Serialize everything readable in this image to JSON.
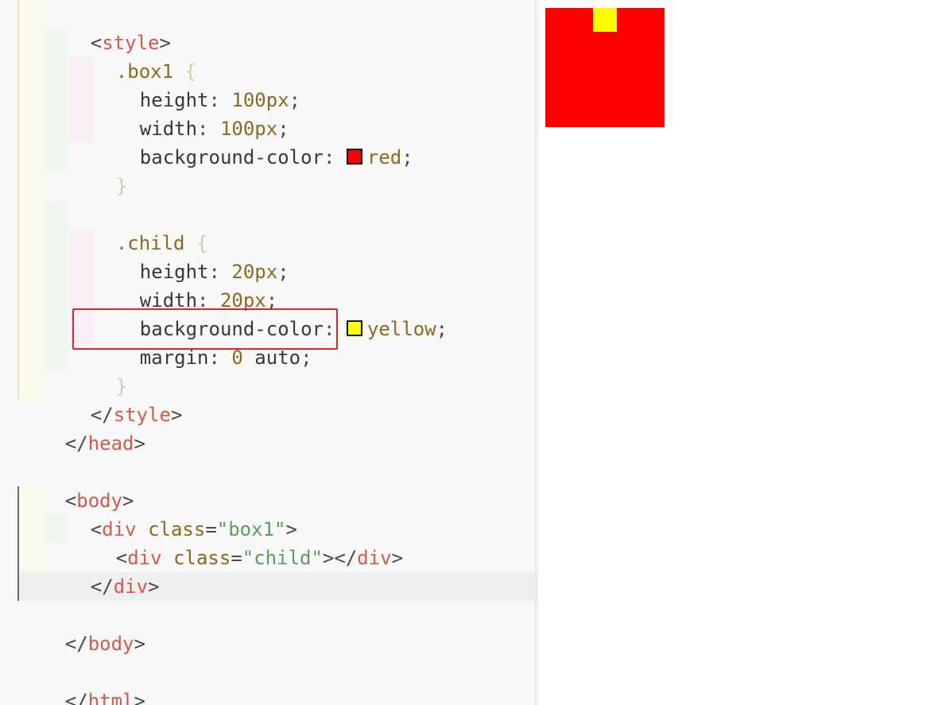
{
  "editor": {
    "lines": {
      "style_open": {
        "open": "<",
        "name": "style",
        "close": ">"
      },
      "box1_selector": {
        "selector": ".box1",
        "brace": "{"
      },
      "box1_height": {
        "prop": "height",
        "colon": ": ",
        "value": "100px",
        "semi": ";"
      },
      "box1_width": {
        "prop": "width",
        "colon": ": ",
        "value": "100px",
        "semi": ";"
      },
      "box1_bg": {
        "prop": "background-color",
        "colon": ": ",
        "value": "red",
        "semi": ";",
        "swatch": "#ff0000"
      },
      "box1_close": {
        "brace": "}"
      },
      "child_selector": {
        "selector": ".child",
        "brace": "{"
      },
      "child_height": {
        "prop": "height",
        "colon": ": ",
        "value": "20px",
        "semi": ";"
      },
      "child_width": {
        "prop": "width",
        "colon": ": ",
        "value": "20px",
        "semi": ";"
      },
      "child_bg": {
        "prop": "background-color",
        "colon": ": ",
        "value": "yellow",
        "semi": ";",
        "swatch": "#ffff00"
      },
      "child_margin": {
        "prop": "margin",
        "colon": ": ",
        "num": "0",
        "value": " auto",
        "semi": ";"
      },
      "child_close": {
        "brace": "}"
      },
      "style_close": {
        "open": "</",
        "name": "style",
        "close": ">"
      },
      "head_close": {
        "open": "</",
        "name": "head",
        "close": ">"
      },
      "body_open": {
        "open": "<",
        "name": "body",
        "close": ">"
      },
      "div_box1_open": {
        "open": "<",
        "name": "div",
        "space": " ",
        "attr": "class",
        "eq": "=",
        "value": "\"box1\"",
        "close": ">"
      },
      "div_child": {
        "open": "<",
        "name": "div",
        "space": " ",
        "attr": "class",
        "eq": "=",
        "value": "\"child\"",
        "close": "></",
        "name2": "div",
        "close2": ">"
      },
      "div_close": {
        "open": "</",
        "name": "div",
        "close": ">"
      },
      "body_close": {
        "open": "</",
        "name": "body",
        "close": ">"
      },
      "html_close": {
        "open": "</",
        "name": "html",
        "close": ">"
      }
    },
    "highlight_color": "#e0262d"
  },
  "preview": {
    "box1_color": "#ff0000",
    "child_color": "#ffff00"
  }
}
